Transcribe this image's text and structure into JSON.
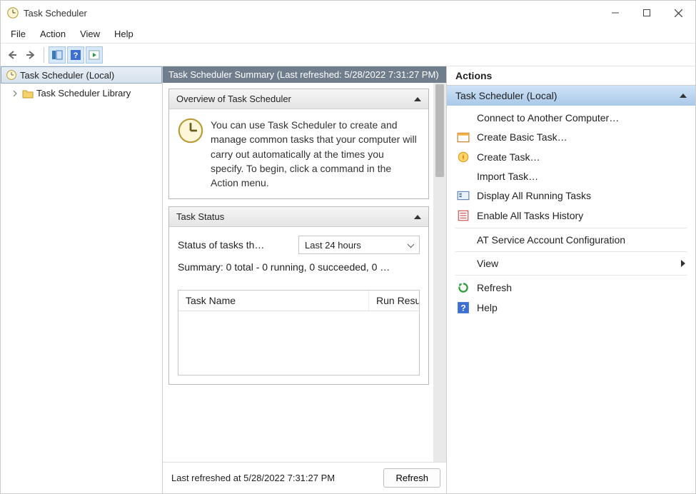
{
  "window": {
    "title": "Task Scheduler"
  },
  "menu": {
    "file": "File",
    "action": "Action",
    "view": "View",
    "help": "Help"
  },
  "tree": {
    "root": "Task Scheduler (Local)",
    "library": "Task Scheduler Library"
  },
  "mid": {
    "banner": "Task Scheduler Summary (Last refreshed: 5/28/2022 7:31:27 PM)",
    "overview_title": "Overview of Task Scheduler",
    "overview_text": "You can use Task Scheduler to create and manage common tasks that your computer will carry out automatically at the times you specify. To begin, click a command in the Action menu.",
    "status_title": "Task Status",
    "status_label": "Status of tasks th…",
    "status_combo": "Last 24 hours",
    "summary_line": "Summary: 0 total - 0 running, 0 succeeded, 0 …",
    "col_task_name": "Task Name",
    "col_run_result": "Run Resu",
    "footer_text": "Last refreshed at 5/28/2022 7:31:27 PM",
    "refresh_btn": "Refresh"
  },
  "actions": {
    "header": "Actions",
    "sub": "Task Scheduler (Local)",
    "items": {
      "connect": "Connect to Another Computer…",
      "create_basic": "Create Basic Task…",
      "create_task": "Create Task…",
      "import_task": "Import Task…",
      "display_running": "Display All Running Tasks",
      "enable_history": "Enable All Tasks History",
      "at_service": "AT Service Account Configuration",
      "view": "View",
      "refresh": "Refresh",
      "help": "Help"
    }
  }
}
